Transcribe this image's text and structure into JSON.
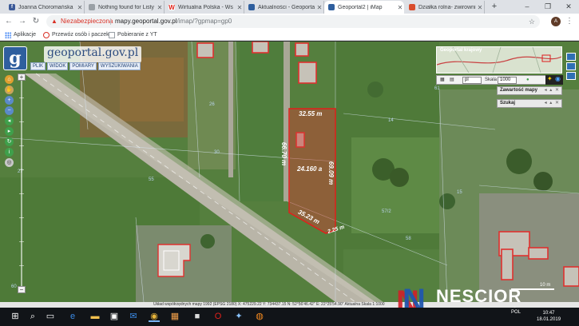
{
  "tabs": [
    {
      "label": "Joanna Choromańska",
      "favicon": "facebook-icon",
      "color": "#3b5998",
      "glyph": "f"
    },
    {
      "label": "Nothing found for Listy",
      "favicon": "page-icon",
      "color": "#5f6368",
      "glyph": ""
    },
    {
      "label": "Wirtualna Polska - Ws",
      "favicon": "wp-icon",
      "color": "#e2231a",
      "glyph": "W"
    },
    {
      "label": "Aktualności - Geoporta",
      "favicon": "geoportal-icon",
      "color": "#2f5f9e",
      "glyph": ""
    },
    {
      "label": "Geoportal2 | iMap",
      "favicon": "geoportal-icon",
      "color": "#2f5f9e",
      "glyph": ""
    },
    {
      "label": "Działka rolna- żwirowni",
      "favicon": "page-icon",
      "color": "#d94c2c",
      "glyph": ""
    }
  ],
  "newtab_label": "+",
  "window": {
    "minimize": "–",
    "maximize": "❐",
    "close": "✕"
  },
  "address": {
    "security_label": "Niezabezpieczona",
    "url_host": "mapy.geoportal.gov.pl",
    "url_path": "/imap/?gpmap=gp0",
    "star": "☆"
  },
  "profile_initial": "A",
  "bookmarks": [
    {
      "label": "Aplikacje",
      "icon": "apps-grid-icon"
    },
    {
      "label": "Przewóz osób i paczek",
      "icon": "bookmark-icon"
    },
    {
      "label": "Pobieranie z YT",
      "icon": "page-icon"
    }
  ],
  "geoportal": {
    "logo_text": "geoportal.gov.pl",
    "menu": [
      "PLIK",
      "WIDOK",
      "POMIARY",
      "WYSZUKIWANIA"
    ],
    "overview_title": "Geoportal krajowy",
    "scale_label": "Skala",
    "scale_value": "1000",
    "zoom_select": "pl",
    "panel_contents": "Zawartość mapy",
    "panel_search": "Szukaj",
    "panel_controls": "◂ ▴ ✕",
    "statusbar_coords": "Układ współrzędnych mapy 1992 (EPSG 2180)   X: 475229.22  Y: 734437.15   N: 52°56'46.42\"  E: 22°25'54.90\"   Aktualna Skala 1:1000",
    "scale_text": "10 m"
  },
  "parcel": {
    "top_len": "32.55 m",
    "left_len": "66.70 m",
    "right_len": "69.09 m",
    "bottom_len": "35.23 m",
    "corner_len": "2.25 m",
    "area": "24.160 a"
  },
  "map_numbers": [
    "26",
    "61",
    "27",
    "55",
    "14",
    "15",
    "30",
    "60",
    "57/2",
    "58"
  ],
  "watermark": {
    "letter": "N",
    "name": "NESCIOR",
    "sub": "NIERUCHOMOŚCI"
  },
  "taskbar": {
    "time": "10:47",
    "date": "18.01.2019",
    "lang": "POL"
  }
}
